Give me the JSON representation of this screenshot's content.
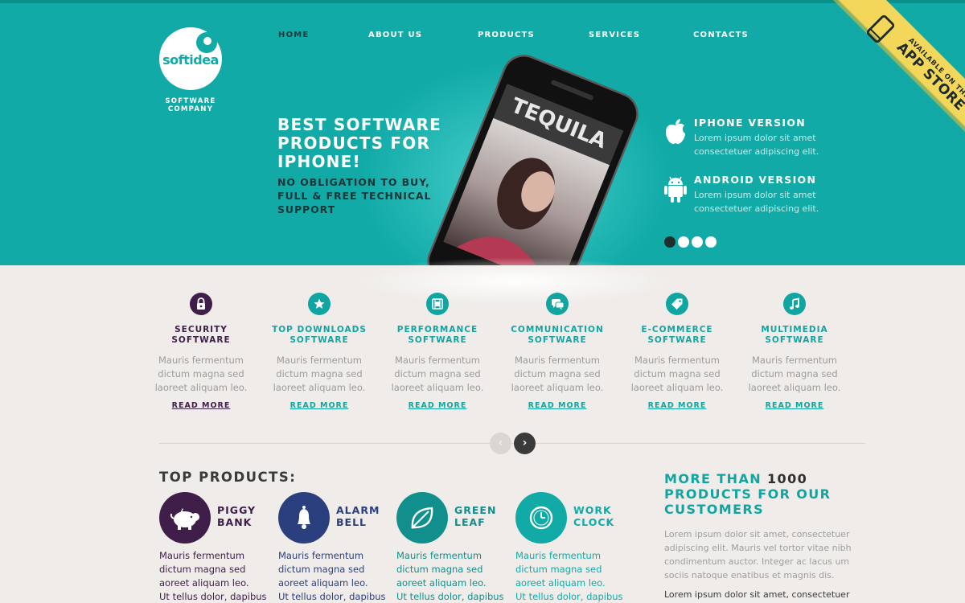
{
  "logo": {
    "text": "softidea",
    "tagline_line1": "SOFTWARE",
    "tagline_line2": "COMPANY"
  },
  "nav": {
    "items": [
      "HOME",
      "ABOUT US",
      "PRODUCTS",
      "SERVICES",
      "CONTACTS"
    ],
    "active": "HOME"
  },
  "hero": {
    "title_line1": "BEST SOFTWARE",
    "title_line2": "PRODUCTS FOR",
    "title_line3": "IPHONE!",
    "sub_line1": "NO OBLIGATION TO BUY,",
    "sub_line2": "FULL & FREE TECHNICAL",
    "sub_line3": "SUPPORT",
    "phone_app_title": "TEQUILA",
    "versions": [
      {
        "title": "IPHONE VERSION",
        "desc_line1": "Lorem ipsum dolor sit amet",
        "desc_line2": "consectetuer adipiscing elit.",
        "icon": "apple-icon"
      },
      {
        "title": "ANDROID VERSION",
        "desc_line1": "Lorem ipsum dolor sit amet",
        "desc_line2": "consectetuer adipiscing elit.",
        "icon": "android-icon"
      }
    ],
    "slider_active_index": 0,
    "slider_count": 4
  },
  "ribbon": {
    "line1": "AVAILABLE ON THE",
    "line2": "APP STORE",
    "icon": "phone-icon"
  },
  "features": [
    {
      "title1": "SECURITY",
      "title2": "SOFTWARE",
      "desc1": "Mauris fermentum",
      "desc2": "dictum magna sed",
      "desc3": "laoreet aliquam leo.",
      "link": "READ MORE",
      "icon": "lock-icon",
      "color": "#3f1e4a"
    },
    {
      "title1": "TOP DOWNLOADS",
      "title2": "SOFTWARE",
      "desc1": "Mauris fermentum",
      "desc2": "dictum magna sed",
      "desc3": "laoreet aliquam leo.",
      "link": "READ MORE",
      "icon": "star-icon",
      "color": "#11a5a2"
    },
    {
      "title1": "PERFORMANCE",
      "title2": "SOFTWARE",
      "desc1": "Mauris fermentum",
      "desc2": "dictum magna sed",
      "desc3": "laoreet aliquam leo.",
      "link": "READ MORE",
      "icon": "film-icon",
      "color": "#11a5a2"
    },
    {
      "title1": "COMMUNICATION",
      "title2": "SOFTWARE",
      "desc1": "Mauris fermentum",
      "desc2": "dictum magna sed",
      "desc3": "laoreet aliquam leo.",
      "link": "READ MORE",
      "icon": "chat-icon",
      "color": "#11a5a2"
    },
    {
      "title1": "E-COMMERCE",
      "title2": "SOFTWARE",
      "desc1": "Mauris fermentum",
      "desc2": "dictum magna sed",
      "desc3": "laoreet aliquam leo.",
      "link": "READ MORE",
      "icon": "tag-icon",
      "color": "#11a5a2"
    },
    {
      "title1": "MULTIMEDIA",
      "title2": "SOFTWARE",
      "desc1": "Mauris fermentum",
      "desc2": "dictum magna sed",
      "desc3": "laoreet aliquam leo.",
      "link": "READ MORE",
      "icon": "music-icon",
      "color": "#11a5a2"
    }
  ],
  "carousel": {
    "prev": "‹",
    "next": "›"
  },
  "top_products": {
    "title": "TOP PRODUCTS:",
    "items": [
      {
        "name1": "PIGGY",
        "name2": "BANK",
        "desc1": "Mauris fermentum",
        "desc2": "dictum magna sed",
        "desc3": "aoreet aliquam leo.",
        "desc4": "Ut tellus dolor, dapibus",
        "icon": "piggy-bank-icon",
        "circle_color": "#3f1e4a",
        "text_color": "#3f1e4a"
      },
      {
        "name1": "ALARM",
        "name2": "BELL",
        "desc1": "Mauris fermentum",
        "desc2": "dictum magna sed",
        "desc3": "aoreet aliquam leo.",
        "desc4": "Ut tellus dolor, dapibus",
        "icon": "bell-icon",
        "circle_color": "#2b3f7f",
        "text_color": "#2b3f7f"
      },
      {
        "name1": "GREEN",
        "name2": "LEAF",
        "desc1": "Mauris fermentum",
        "desc2": "dictum magna sed",
        "desc3": "aoreet aliquam leo.",
        "desc4": "Ut tellus dolor, dapibus",
        "icon": "leaf-icon",
        "circle_color": "#118f8c",
        "text_color": "#118f8c"
      },
      {
        "name1": "WORK",
        "name2": "CLOCK",
        "desc1": "Mauris fermentum",
        "desc2": "dictum magna sed",
        "desc3": "aoreet aliquam leo.",
        "desc4": "Ut tellus dolor, dapibus",
        "icon": "clock-icon",
        "circle_color": "#11aaa7",
        "text_color": "#11aaa7"
      }
    ]
  },
  "customers": {
    "title_prefix": "MORE THAN",
    "title_number": "1000",
    "title_line2": "PRODUCTS FOR OUR",
    "title_line3": "CUSTOMERS",
    "desc_lines": [
      "Lorem ipsum dolor sit amet, consectetuer",
      "adipiscing elit. Mauris vel tortor vitae nibh",
      "condimentum auctor. Integer ac lacus um",
      "sociis natoque enatibus et magnis dis."
    ],
    "desc2_line1": "Lorem ipsum dolor sit amet, consectetuer"
  },
  "colors": {
    "teal": "#11aaa7",
    "dark_purple": "#3f1e4a",
    "navy": "#2b3f7f",
    "background": "#efece9"
  }
}
